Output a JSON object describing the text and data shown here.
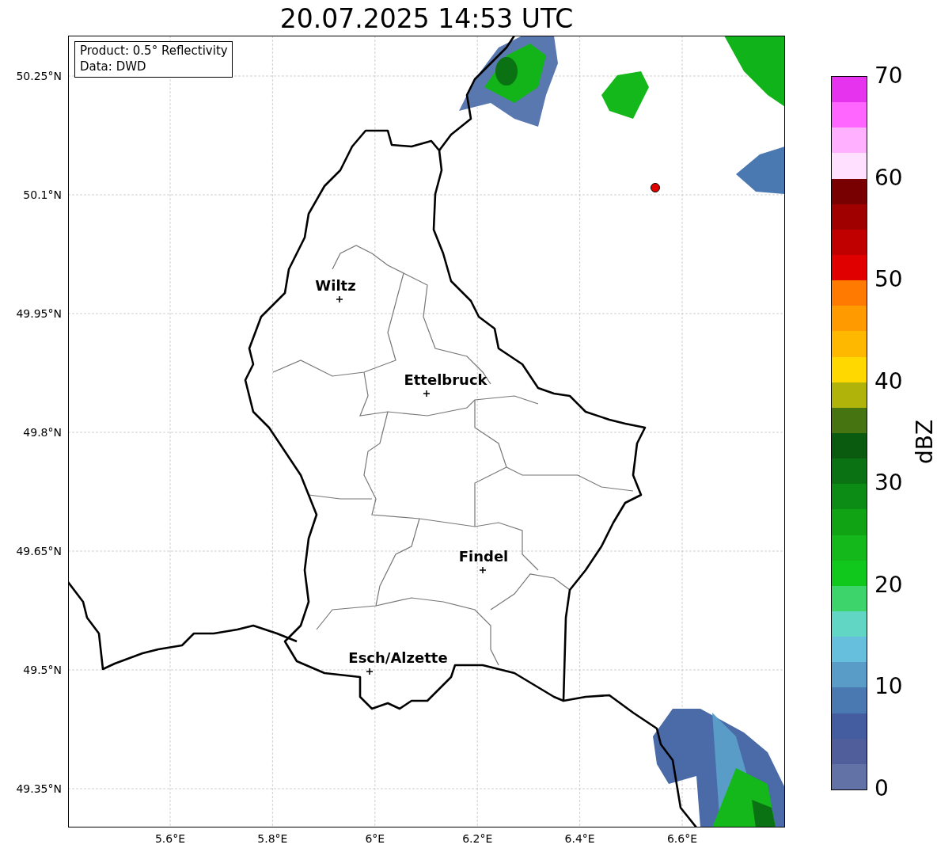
{
  "title": "20.07.2025 14:53 UTC",
  "info_box": [
    "Product: 0.5° Reflectivity",
    "Data: DWD"
  ],
  "map": {
    "yticks": [
      "50.25°N",
      "50.1°N",
      "49.95°N",
      "49.8°N",
      "49.65°N",
      "49.5°N",
      "49.35°N"
    ],
    "xticks": [
      "5.6°E",
      "5.8°E",
      "6°E",
      "6.2°E",
      "6.4°E",
      "6.6°E"
    ],
    "cities": [
      {
        "name": "Wiltz"
      },
      {
        "name": "Ettelbruck"
      },
      {
        "name": "Findel"
      },
      {
        "name": "Esch/Alzette"
      }
    ]
  },
  "colorbar": {
    "label": "dBZ",
    "ticks": [
      "70",
      "60",
      "50",
      "40",
      "30",
      "20",
      "10",
      "0"
    ],
    "bins": [
      {
        "color": "#e633ee"
      },
      {
        "color": "#ff66ff"
      },
      {
        "color": "#ffb0ff"
      },
      {
        "color": "#ffe0ff"
      },
      {
        "color": "#780000"
      },
      {
        "color": "#a00000"
      },
      {
        "color": "#c00000"
      },
      {
        "color": "#e00000"
      },
      {
        "color": "#ff7a00"
      },
      {
        "color": "#ff9a00"
      },
      {
        "color": "#ffb800"
      },
      {
        "color": "#ffd800"
      },
      {
        "color": "#b0b40a"
      },
      {
        "color": "#467410"
      },
      {
        "color": "#0a5a10"
      },
      {
        "color": "#0a7212"
      },
      {
        "color": "#0c8c14"
      },
      {
        "color": "#10a414"
      },
      {
        "color": "#14b81a"
      },
      {
        "color": "#10c81c"
      },
      {
        "color": "#3ed46c"
      },
      {
        "color": "#62d6c4"
      },
      {
        "color": "#66c0dd"
      },
      {
        "color": "#5a9cc8"
      },
      {
        "color": "#4a78b0"
      },
      {
        "color": "#445da0"
      },
      {
        "color": "#505f9c"
      },
      {
        "color": "#6272a6"
      }
    ]
  }
}
